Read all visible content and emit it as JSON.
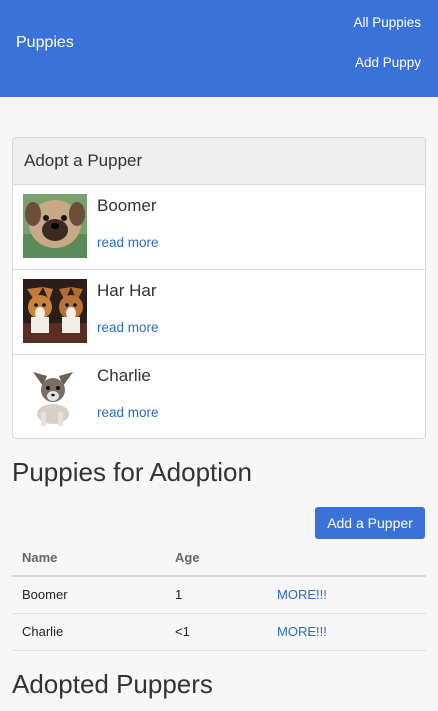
{
  "navbar": {
    "brand": "Puppies",
    "links": [
      "All Puppies",
      "Add Puppy"
    ]
  },
  "featured": {
    "header": "Adopt a Pupper",
    "items": [
      {
        "name": "Boomer",
        "link": "read more",
        "photo": "pug-puppy-photo"
      },
      {
        "name": "Har Har",
        "link": "read more",
        "photo": "corgi-puppies-photo"
      },
      {
        "name": "Charlie",
        "link": "read more",
        "photo": "chihuahua-puppy-photo"
      }
    ]
  },
  "adoption": {
    "title": "Puppies for Adoption",
    "add_button": "Add a Pupper",
    "columns": [
      "Name",
      "Age"
    ],
    "rows": [
      {
        "name": "Boomer",
        "age": "1",
        "link": "MORE!!!"
      },
      {
        "name": "Charlie",
        "age": "<1",
        "link": "MORE!!!"
      }
    ]
  },
  "adopted": {
    "title": "Adopted Puppers"
  },
  "colors": {
    "navbar": "#3a72d8",
    "link": "#2a6cc8",
    "button": "#3a72d8"
  }
}
